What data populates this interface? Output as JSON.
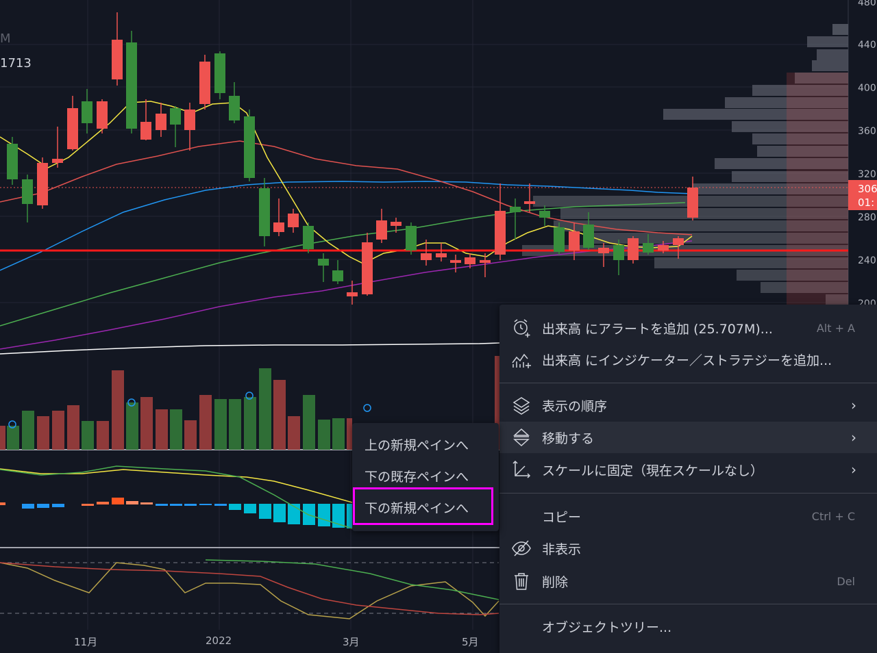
{
  "legend": {
    "interval_fragment": "M",
    "value_fragment": "1713"
  },
  "price_axis": {
    "labels": [
      "480",
      "440",
      "400",
      "360",
      "320",
      "280",
      "240",
      "200"
    ],
    "current_price": "306",
    "countdown": "01:"
  },
  "time_axis": {
    "labels": [
      "11月",
      "2022",
      "3月",
      "5月"
    ]
  },
  "context_menu": {
    "items": [
      {
        "label": "出来高 にアラートを追加 (25.707M)...",
        "shortcut": "Alt + A",
        "icon": "alarm-clock-plus-icon"
      },
      {
        "label": "出来高 にインジケーター／ストラテジーを追加...",
        "icon": "indicator-add-icon"
      },
      {
        "label": "表示の順序",
        "icon": "layers-icon",
        "submenu": true
      },
      {
        "label": "移動する",
        "icon": "move-pane-icon",
        "submenu": true,
        "hovered": true
      },
      {
        "label": "スケールに固定（現在スケールなし）",
        "icon": "axis-scale-icon",
        "submenu": true
      },
      {
        "label": "コピー",
        "shortcut": "Ctrl + C"
      },
      {
        "label": "非表示",
        "icon": "eye-off-icon"
      },
      {
        "label": "削除",
        "shortcut": "Del",
        "icon": "trash-icon"
      },
      {
        "label": "オブジェクトツリー..."
      }
    ]
  },
  "submenu": {
    "items": [
      {
        "label": "上の新規ペインへ"
      },
      {
        "label": "下の既存ペインへ"
      },
      {
        "label": "下の新規ペインへ",
        "highlighted": true
      }
    ],
    "highlight_color": "#ff00ff"
  },
  "colors": {
    "background": "#131722",
    "up_candle": "#388e3c",
    "down_candle": "#ef5350",
    "support_line": "#ff1a1a",
    "ma_yellow": "#f5e642",
    "ma_red": "#e0524f",
    "ma_blue": "#2196f3",
    "ma_green": "#4caf50",
    "ma_purple": "#9c27b0",
    "ma_white": "#ffffff",
    "macd_histogram_cyan": "#00bcd4"
  }
}
